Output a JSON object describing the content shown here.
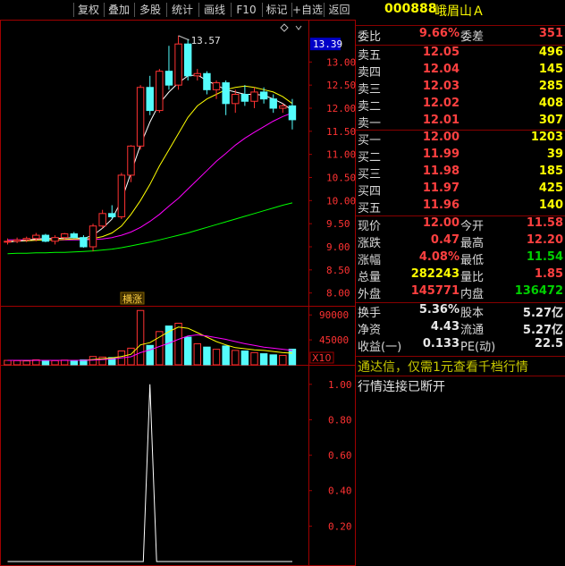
{
  "toolbar": {
    "items": [
      "复权",
      "叠加",
      "多股",
      "统计",
      "画线",
      "F10",
      "标记",
      "+自选",
      "返回"
    ]
  },
  "stock": {
    "code": "000888",
    "name": "峨眉山Ａ"
  },
  "ratio": {
    "label": "委比",
    "value": "9.66%",
    "label2": "委差",
    "value2": "351"
  },
  "asks": [
    {
      "label": "卖五",
      "price": "12.05",
      "vol": "496"
    },
    {
      "label": "卖四",
      "price": "12.04",
      "vol": "145"
    },
    {
      "label": "卖三",
      "price": "12.03",
      "vol": "285"
    },
    {
      "label": "卖二",
      "price": "12.02",
      "vol": "408"
    },
    {
      "label": "卖一",
      "price": "12.01",
      "vol": "307"
    }
  ],
  "bids": [
    {
      "label": "买一",
      "price": "12.00",
      "vol": "1203"
    },
    {
      "label": "买二",
      "price": "11.99",
      "vol": "39"
    },
    {
      "label": "买三",
      "price": "11.98",
      "vol": "185"
    },
    {
      "label": "买四",
      "price": "11.97",
      "vol": "425"
    },
    {
      "label": "买五",
      "price": "11.96",
      "vol": "140"
    }
  ],
  "quote": [
    {
      "l1": "现价",
      "v1": "12.00",
      "l2": "今开",
      "v2": "11.58"
    },
    {
      "l1": "涨跌",
      "v1": "0.47",
      "l2": "最高",
      "v2": "12.20"
    },
    {
      "l1": "涨幅",
      "v1": "4.08%",
      "l2": "最低",
      "v2": "11.54"
    },
    {
      "l1": "总量",
      "v1": "282243",
      "l2": "量比",
      "v2": "1.85"
    },
    {
      "l1": "外盘",
      "v1": "145771",
      "l2": "内盘",
      "v2": "136472"
    }
  ],
  "fundamentals": [
    {
      "l1": "换手",
      "v1": "5.36%",
      "l2": "股本",
      "v2": "5.27亿"
    },
    {
      "l1": "净资",
      "v1": "4.43",
      "l2": "流通",
      "v2": "5.27亿"
    },
    {
      "l1": "收益(一)",
      "v1": "0.133",
      "l2": "PE(动)",
      "v2": "22.5"
    }
  ],
  "notice": "通达信，仅需1元查看千档行情",
  "connection": "行情连接已断开",
  "chart": {
    "price_axis": [
      "13.00",
      "12.50",
      "12.00",
      "11.50",
      "11.00",
      "10.50",
      "10.00",
      "9.50",
      "9.00",
      "8.50",
      "8.00"
    ],
    "last_price_tag": "13.39",
    "high_label": "13.57",
    "event_label": "横涨",
    "volume_axis": [
      "90000",
      "45000"
    ],
    "volume_unit": "X10",
    "indicator_axis": [
      "1.00",
      "0.80",
      "0.60",
      "0.40",
      "0.20"
    ]
  },
  "chart_data": [
    {
      "type": "candlestick",
      "ylim": [
        7.8,
        13.8
      ],
      "ohlc": [
        [
          9.1,
          9.18,
          9.05,
          9.12
        ],
        [
          9.12,
          9.2,
          9.08,
          9.15
        ],
        [
          9.15,
          9.22,
          9.1,
          9.18
        ],
        [
          9.18,
          9.3,
          9.12,
          9.25
        ],
        [
          9.25,
          9.28,
          9.1,
          9.12
        ],
        [
          9.12,
          9.25,
          9.05,
          9.2
        ],
        [
          9.2,
          9.3,
          9.15,
          9.28
        ],
        [
          9.28,
          9.32,
          9.18,
          9.2
        ],
        [
          9.2,
          9.25,
          8.98,
          9.0
        ],
        [
          9.0,
          9.5,
          8.9,
          9.45
        ],
        [
          9.45,
          9.8,
          9.4,
          9.72
        ],
        [
          9.72,
          9.9,
          9.6,
          9.65
        ],
        [
          9.65,
          10.6,
          9.6,
          10.55
        ],
        [
          10.55,
          11.2,
          10.4,
          11.18
        ],
        [
          11.18,
          12.5,
          11.1,
          12.45
        ],
        [
          12.45,
          12.7,
          11.85,
          11.95
        ],
        [
          11.95,
          12.85,
          11.9,
          12.8
        ],
        [
          12.8,
          13.35,
          12.4,
          12.5
        ],
        [
          12.5,
          13.57,
          12.4,
          13.39
        ],
        [
          13.39,
          13.5,
          12.6,
          12.7
        ],
        [
          12.7,
          12.85,
          12.6,
          12.75
        ],
        [
          12.75,
          12.8,
          12.3,
          12.4
        ],
        [
          12.4,
          12.6,
          12.2,
          12.55
        ],
        [
          12.55,
          12.6,
          11.85,
          12.1
        ],
        [
          12.1,
          12.4,
          11.9,
          12.3
        ],
        [
          12.3,
          12.5,
          12.05,
          12.15
        ],
        [
          12.15,
          12.45,
          12.0,
          12.35
        ],
        [
          12.35,
          12.45,
          12.1,
          12.2
        ],
        [
          12.2,
          12.3,
          11.9,
          12.0
        ],
        [
          12.0,
          12.1,
          11.9,
          12.05
        ],
        [
          12.05,
          12.2,
          11.54,
          11.75
        ]
      ],
      "ma5": [
        9.1,
        9.12,
        9.14,
        9.17,
        9.18,
        9.18,
        9.19,
        9.2,
        9.18,
        9.25,
        9.4,
        9.6,
        10.0,
        10.6,
        11.2,
        11.7,
        12.1,
        12.35,
        12.55,
        12.7,
        12.72,
        12.6,
        12.5,
        12.4,
        12.35,
        12.3,
        12.3,
        12.28,
        12.2,
        12.1,
        11.95
      ],
      "ma10": [
        9.12,
        9.12,
        9.13,
        9.14,
        9.15,
        9.15,
        9.16,
        9.17,
        9.17,
        9.18,
        9.22,
        9.3,
        9.45,
        9.7,
        10.0,
        10.35,
        10.75,
        11.1,
        11.45,
        11.8,
        12.05,
        12.2,
        12.3,
        12.4,
        12.45,
        12.48,
        12.45,
        12.4,
        12.35,
        12.25,
        12.1
      ],
      "ma20": [
        9.15,
        9.15,
        9.15,
        9.15,
        9.15,
        9.15,
        9.15,
        9.15,
        9.15,
        9.16,
        9.17,
        9.2,
        9.25,
        9.32,
        9.42,
        9.55,
        9.7,
        9.88,
        10.05,
        10.25,
        10.45,
        10.65,
        10.85,
        11.02,
        11.2,
        11.35,
        11.48,
        11.6,
        11.72,
        11.82,
        11.9
      ],
      "ma60": [
        8.85,
        8.86,
        8.86,
        8.87,
        8.87,
        8.88,
        8.88,
        8.89,
        8.9,
        8.91,
        8.93,
        8.95,
        8.98,
        9.02,
        9.06,
        9.1,
        9.15,
        9.2,
        9.25,
        9.3,
        9.36,
        9.42,
        9.48,
        9.54,
        9.6,
        9.66,
        9.72,
        9.78,
        9.84,
        9.9,
        9.95
      ]
    },
    {
      "type": "bar",
      "ylim": [
        0,
        100000
      ],
      "values": [
        8000,
        7500,
        7000,
        9000,
        8000,
        7500,
        8500,
        7000,
        9000,
        15000,
        14000,
        13000,
        25000,
        30000,
        98000,
        35000,
        60000,
        70000,
        75000,
        50000,
        38000,
        32000,
        28000,
        34000,
        26000,
        25000,
        22000,
        20000,
        18000,
        17000,
        28224
      ],
      "ma1": [
        8000,
        8000,
        7800,
        8000,
        8000,
        8000,
        8000,
        8000,
        8000,
        9500,
        11000,
        12500,
        15000,
        19000,
        36000,
        40000,
        50000,
        60000,
        68000,
        66000,
        58000,
        50000,
        42000,
        36000,
        31000,
        29000,
        27000,
        26000,
        24000,
        22000,
        21000
      ],
      "ma2": [
        8000,
        8000,
        8000,
        8000,
        8000,
        8000,
        8000,
        8000,
        8000,
        8500,
        9500,
        10500,
        12500,
        14500,
        22000,
        27000,
        33000,
        39000,
        46000,
        52000,
        54000,
        52000,
        49000,
        46000,
        42000,
        38000,
        35000,
        32000,
        30000,
        28000,
        26000
      ]
    },
    {
      "type": "line",
      "ylim": [
        0,
        1.1
      ],
      "values": [
        0,
        0,
        0,
        0,
        0,
        0,
        0,
        0,
        0,
        0,
        0,
        0,
        0,
        0,
        0,
        1.0,
        0,
        0,
        0,
        0,
        0,
        0,
        0,
        0,
        0,
        0,
        0,
        0,
        0,
        0,
        0
      ]
    }
  ]
}
